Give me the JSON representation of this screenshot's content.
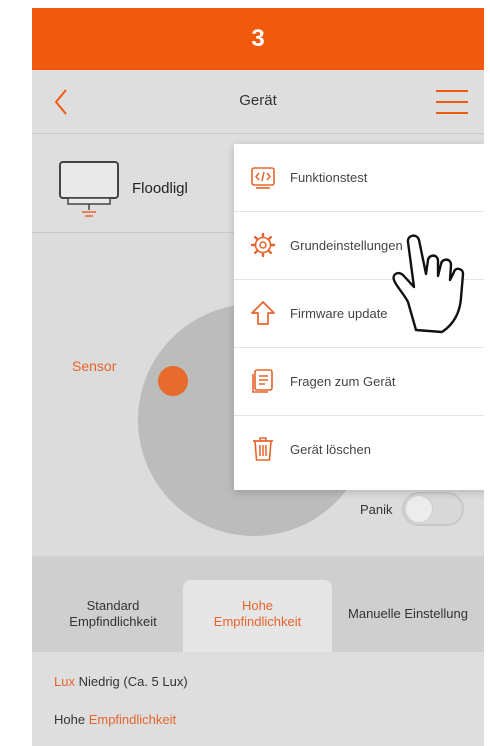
{
  "step": "3",
  "nav": {
    "title": "Gerät"
  },
  "device": {
    "name": "Floodligl"
  },
  "sensor": {
    "label": "Sensor"
  },
  "panik": {
    "label": "Panik"
  },
  "tabs": [
    {
      "line1": "Standard",
      "line2": "Empfindlichkeit"
    },
    {
      "line1": "Hohe",
      "line2": "Empfindlichkeit"
    },
    {
      "line1": "Manuelle Einstellung",
      "line2": ""
    }
  ],
  "info": {
    "row1_highlight": "Lux",
    "row1_text": " Niedrig (Ca. 5 Lux)",
    "row2_text": "Hohe ",
    "row2_highlight": "Empfindlichkeit"
  },
  "menu": {
    "items": [
      {
        "label": "Funktionstest",
        "icon": "code-icon"
      },
      {
        "label": "Grundeinstellungen",
        "icon": "gear-icon"
      },
      {
        "label": "Firmware update",
        "icon": "upload-arrow-icon"
      },
      {
        "label": "Fragen zum Gerät",
        "icon": "document-icon"
      },
      {
        "label": "Gerät löschen",
        "icon": "trash-icon"
      }
    ]
  },
  "colors": {
    "accent": "#f15a0e",
    "menu_icon": "#e6642c"
  }
}
